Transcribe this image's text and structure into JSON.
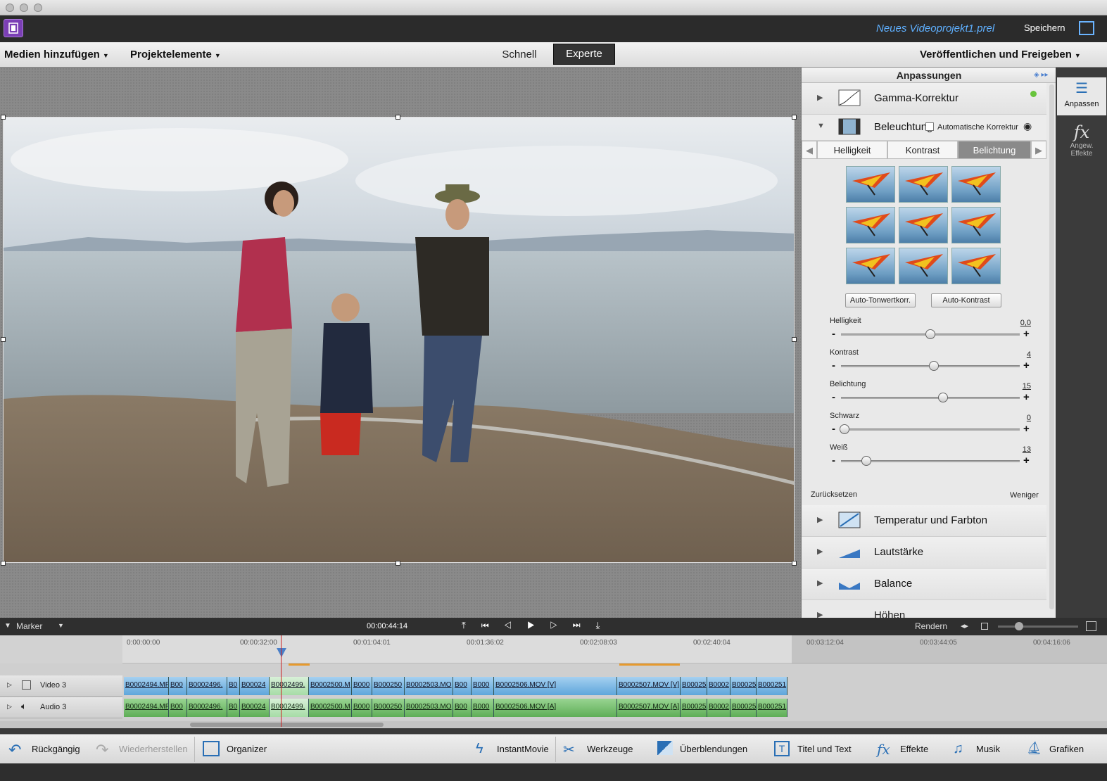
{
  "app": {
    "project_title": "Neues Videoprojekt1.prel",
    "save_label": "Speichern"
  },
  "menubar": {
    "add_media": "Medien hinzufügen",
    "project_elements": "Projektelemente",
    "mode_quick": "Schnell",
    "mode_expert": "Experte",
    "publish": "Veröffentlichen und Freigeben"
  },
  "panel": {
    "title": "Anpassungen",
    "gamma": "Gamma-Korrektur",
    "lighting": "Beleuchtung",
    "auto_correction": "Automatische Korrektur",
    "tabs": [
      "Helligkeit",
      "Kontrast",
      "Belichtung"
    ],
    "btn_auto_tone": "Auto-Tonwertkorr.",
    "btn_auto_contrast": "Auto-Kontrast",
    "sliders": [
      {
        "label": "Helligkeit",
        "value": "0,0",
        "level": 0.5
      },
      {
        "label": "Kontrast",
        "value": "4",
        "level": 0.52
      },
      {
        "label": "Belichtung",
        "value": "15",
        "level": 0.57
      },
      {
        "label": "Schwarz",
        "value": "0",
        "level": 0.02
      },
      {
        "label": "Weiß",
        "value": "13",
        "level": 0.14
      }
    ],
    "reset": "Zurücksetzen",
    "less": "Weniger",
    "temperature": "Temperatur und Farbton",
    "volume": "Lautstärke",
    "balance": "Balance",
    "treble": "Höhen"
  },
  "rail": {
    "adjust": "Anpassen",
    "applied_line1": "Angew.",
    "applied_line2": "Effekte"
  },
  "transport": {
    "marker": "Marker",
    "timecode": "00:00:44:14",
    "render": "Rendern"
  },
  "ruler": [
    "0:00:00:00",
    "00:00:32:00",
    "00:01:04:01",
    "00:01:36:02",
    "00:02:08:03",
    "00:02:40:04",
    "00:03:12:04",
    "00:03:44:05",
    "00:04:16:06"
  ],
  "tracks": {
    "video_name": "Video 3",
    "audio_name": "Audio 3",
    "video_clips": [
      "B0002494.MP",
      "B00",
      "B0002496.",
      "B0",
      "B00024",
      "B0002499.",
      "B0002500.M",
      "B000",
      "B000250",
      "B0002503.MO",
      "B00",
      "B000",
      "B0002506.MOV [V]",
      "B0002507.MOV [V]",
      "B00025",
      "B0002",
      "B00025",
      "B000251"
    ],
    "audio_clips": [
      "B0002494.MP",
      "B00",
      "B0002496.",
      "B0",
      "B00024",
      "B0002499.",
      "B0002500.M",
      "B000",
      "B000250",
      "B0002503.MO",
      "B00",
      "B000",
      "B0002506.MOV [A]",
      "B0002507.MOV [A]",
      "B00025",
      "B0002",
      "B00025",
      "B000251"
    ]
  },
  "bottombar": {
    "undo": "Rückgängig",
    "redo": "Wiederherstellen",
    "organizer": "Organizer",
    "instantmovie": "InstantMovie",
    "tools": "Werkzeuge",
    "transitions": "Überblendungen",
    "titles": "Titel und Text",
    "effects": "Effekte",
    "music": "Musik",
    "graphics": "Grafiken"
  },
  "colors": {
    "accent": "#5ea6db",
    "audio": "#5fae57",
    "playhead": "#cc2222"
  }
}
